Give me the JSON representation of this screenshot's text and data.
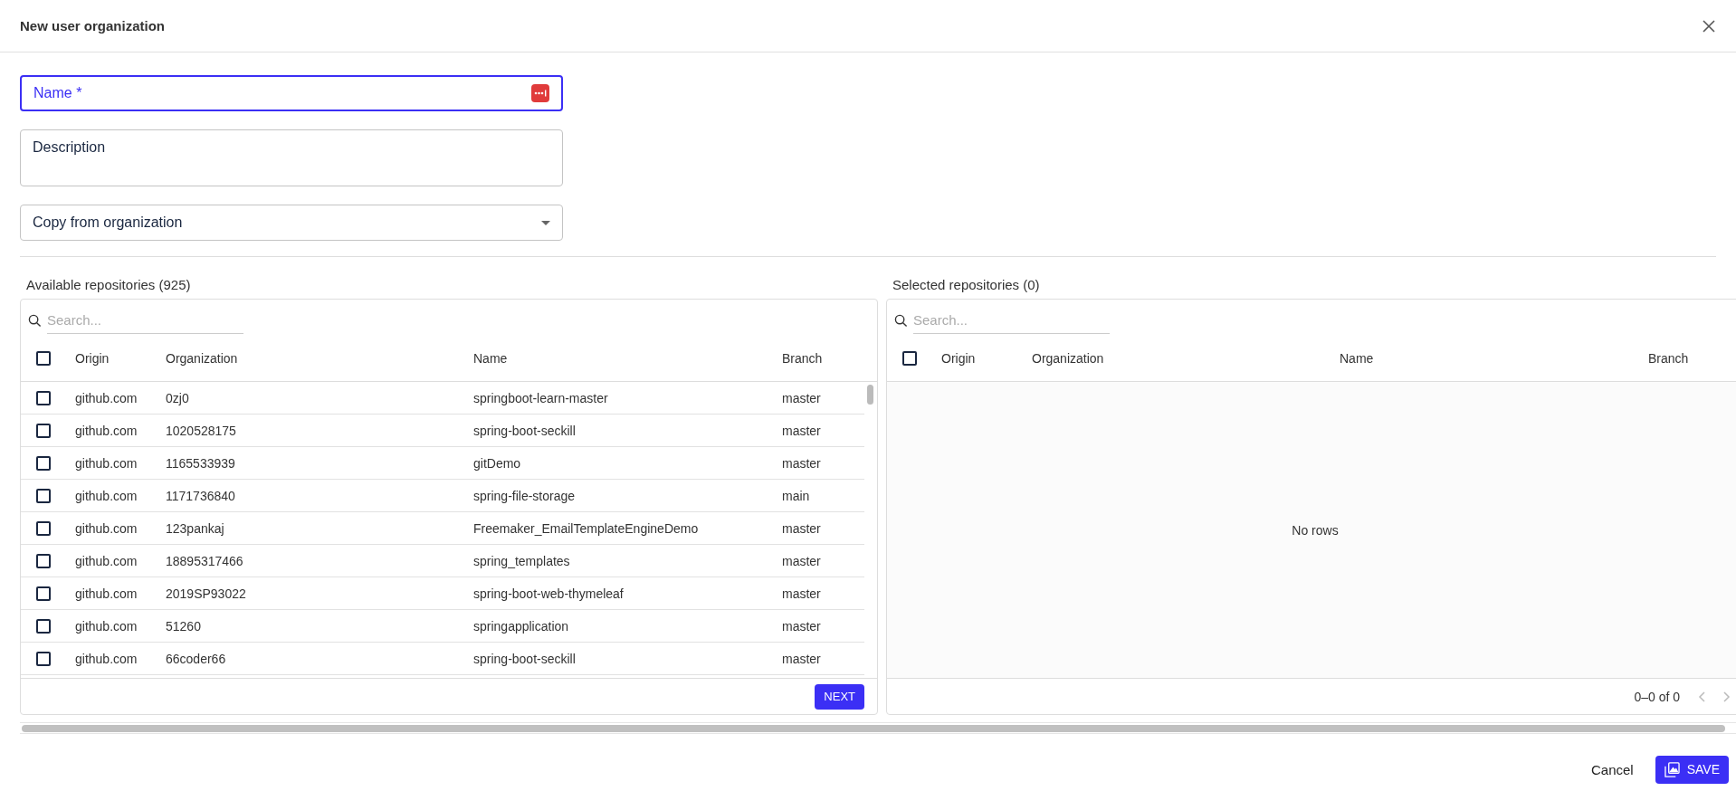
{
  "dialog": {
    "title": "New user organization"
  },
  "form": {
    "name": {
      "label": "Name",
      "required_mark": "*",
      "focused": true
    },
    "description": {
      "label": "Description"
    },
    "copy_from": {
      "label": "Copy from organization"
    }
  },
  "available": {
    "title": "Available repositories (925)",
    "search": {
      "placeholder": "Search..."
    },
    "select_all_checked": false,
    "columns": [
      "Origin",
      "Organization",
      "Name",
      "Branch"
    ],
    "rows": [
      {
        "origin": "github.com",
        "organization": "0zj0",
        "name": "springboot-learn-master",
        "branch": "master",
        "checked": false
      },
      {
        "origin": "github.com",
        "organization": "1020528175",
        "name": "spring-boot-seckill",
        "branch": "master",
        "checked": false
      },
      {
        "origin": "github.com",
        "organization": "1165533939",
        "name": "gitDemo",
        "branch": "master",
        "checked": false
      },
      {
        "origin": "github.com",
        "organization": "1171736840",
        "name": "spring-file-storage",
        "branch": "main",
        "checked": false
      },
      {
        "origin": "github.com",
        "organization": "123pankaj",
        "name": "Freemaker_EmailTemplateEngineDemo",
        "branch": "master",
        "checked": false
      },
      {
        "origin": "github.com",
        "organization": "18895317466",
        "name": "spring_templates",
        "branch": "master",
        "checked": false
      },
      {
        "origin": "github.com",
        "organization": "2019SP93022",
        "name": "spring-boot-web-thymeleaf",
        "branch": "master",
        "checked": false
      },
      {
        "origin": "github.com",
        "organization": "51260",
        "name": "springapplication",
        "branch": "master",
        "checked": false
      },
      {
        "origin": "github.com",
        "organization": "66coder66",
        "name": "spring-boot-seckill",
        "branch": "master",
        "checked": false
      }
    ],
    "next_button": "NEXT"
  },
  "selected": {
    "title": "Selected repositories (0)",
    "search": {
      "placeholder": "Search..."
    },
    "select_all_checked": false,
    "columns": [
      "Origin",
      "Organization",
      "Name",
      "Branch"
    ],
    "empty_text": "No rows",
    "pagination": "0–0 of 0"
  },
  "footer": {
    "cancel": "Cancel",
    "save": "SAVE"
  }
}
